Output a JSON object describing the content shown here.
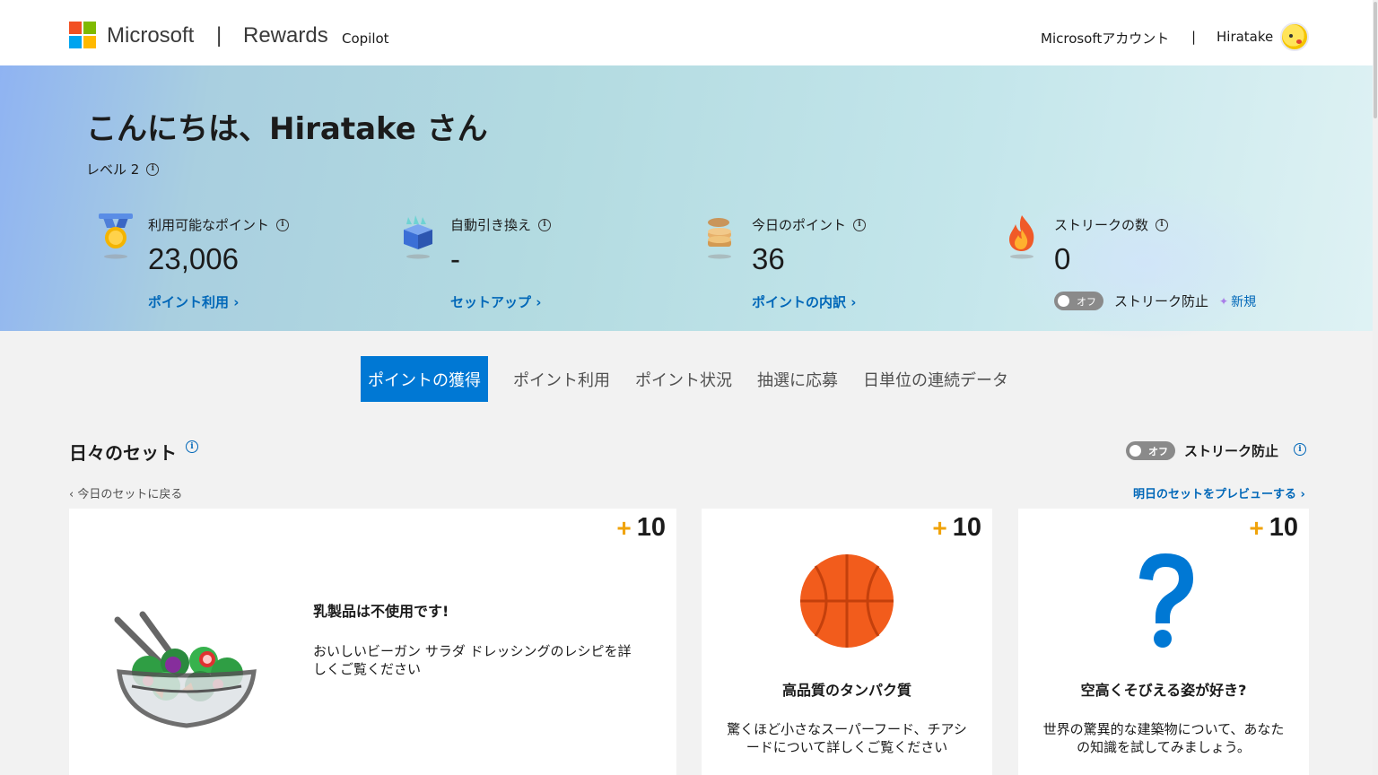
{
  "header": {
    "brand": "Microsoft",
    "separator": "|",
    "product": "Rewards",
    "copilot": "Copilot",
    "account_link": "Microsoftアカウント",
    "account_separator": "|",
    "username": "Hiratake",
    "logo_colors": [
      "#f25022",
      "#7fba00",
      "#00a4ef",
      "#ffb900"
    ]
  },
  "hero": {
    "greeting": "こんにちは、Hiratake さん",
    "level": "レベル 2",
    "stats": [
      {
        "label": "利用可能なポイント",
        "value": "23,006",
        "link": "ポイント利用 ›",
        "icon": "medal-icon"
      },
      {
        "label": "自動引き換え",
        "value": "-",
        "link": "セットアップ ›",
        "icon": "gift-box-icon"
      },
      {
        "label": "今日のポイント",
        "value": "36",
        "link": "ポイントの内訳 ›",
        "icon": "coin-stack-icon"
      },
      {
        "label": "ストリークの数",
        "value": "0",
        "icon": "flame-icon"
      }
    ],
    "streak_toggle": "オフ",
    "streak_protect": "ストリーク防止",
    "new_label": "新規"
  },
  "tabs": [
    {
      "label": "ポイントの獲得",
      "active": true
    },
    {
      "label": "ポイント利用",
      "active": false
    },
    {
      "label": "ポイント状況",
      "active": false
    },
    {
      "label": "抽選に応募",
      "active": false
    },
    {
      "label": "日単位の連続データ",
      "active": false
    }
  ],
  "daily_set": {
    "title": "日々のセット",
    "toggle": "オフ",
    "streak_protect": "ストリーク防止",
    "back_link": "‹ 今日のセットに戻る",
    "preview_link": "明日のセットをプレビューする ›",
    "cards": [
      {
        "points": "10",
        "title": "乳製品は不使用です!",
        "desc": "おいしいビーガン サラダ ドレッシングのレシピを詳しくご覧ください",
        "icon": "salad-bowl-icon"
      },
      {
        "points": "10",
        "title": "高品質のタンパク質",
        "desc": "驚くほど小さなスーパーフード、チアシードについて詳しくご覧ください",
        "icon": "basketball-icon"
      },
      {
        "points": "10",
        "title": "空高くそびえる姿が好き?",
        "desc": "世界の驚異的な建築物について、あなたの知識を試してみましょう。",
        "icon": "question-mark-icon"
      }
    ]
  },
  "colors": {
    "accent": "#0078d4",
    "link": "#0067b8",
    "points_plus": "#f0a30a"
  }
}
